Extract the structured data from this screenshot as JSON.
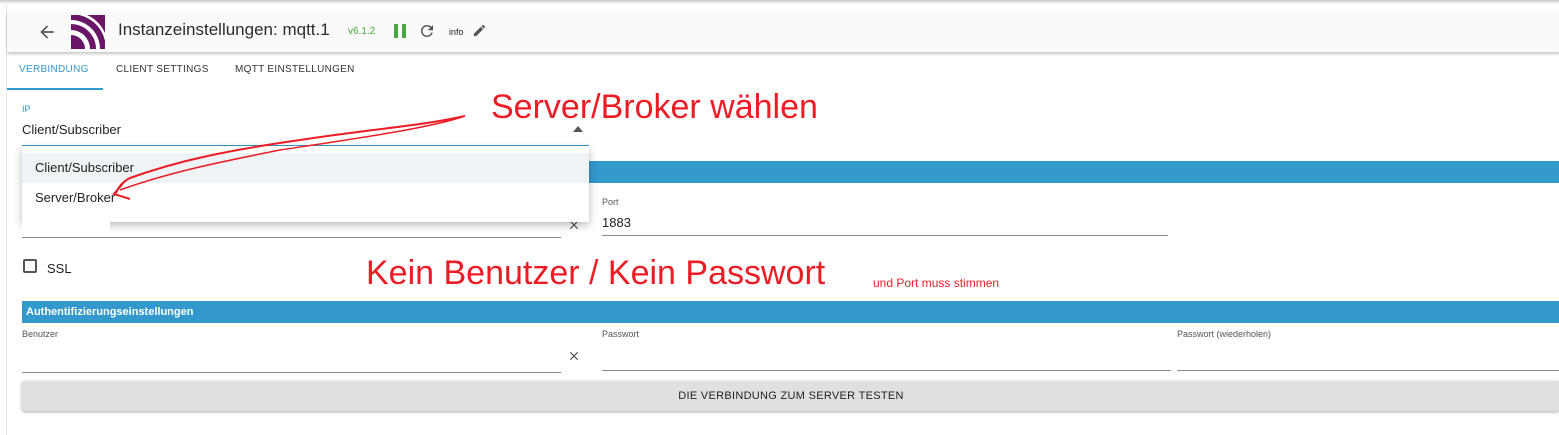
{
  "header": {
    "title": "Instanzeinstellungen: mqtt.1",
    "version": "v6.1.2",
    "info_label": "info",
    "colors": {
      "logo": "#6b1567",
      "version": "#49a83d",
      "pause": "#49a83d"
    },
    "icons": [
      "back-arrow-icon",
      "mqtt-logo-icon",
      "pause-icon",
      "reload-icon",
      "edit-pencil-icon"
    ]
  },
  "tabs": [
    {
      "label": "VERBINDUNG",
      "active": true
    },
    {
      "label": "CLIENT SETTINGS",
      "active": false
    },
    {
      "label": "MQTT EINSTELLUNGEN",
      "active": false
    }
  ],
  "connection": {
    "ip_label": "IP",
    "ip_value": "Client/Subscriber",
    "ip_options": [
      "Client/Subscriber",
      "Server/Broker"
    ],
    "port_label": "Port",
    "port_value": "1883",
    "ssl_label": "SSL",
    "ssl_checked": false
  },
  "auth": {
    "section_title": "Authentifizierungseinstellungen",
    "user_label": "Benutzer",
    "user_value": "",
    "password_label": "Passwort",
    "password_value": "",
    "password_repeat_label": "Passwort (wiederholen)",
    "password_repeat_value": ""
  },
  "actions": {
    "test_button": "DIE VERBINDUNG ZUM SERVER TESTEN"
  },
  "annotations": {
    "color": "#ed1c24",
    "select_hint": "Server/Broker wählen",
    "auth_hint": "Kein Benutzer / Kein Passwort",
    "port_hint": "und Port muss stimmen"
  },
  "accent_color": "#3399cc"
}
